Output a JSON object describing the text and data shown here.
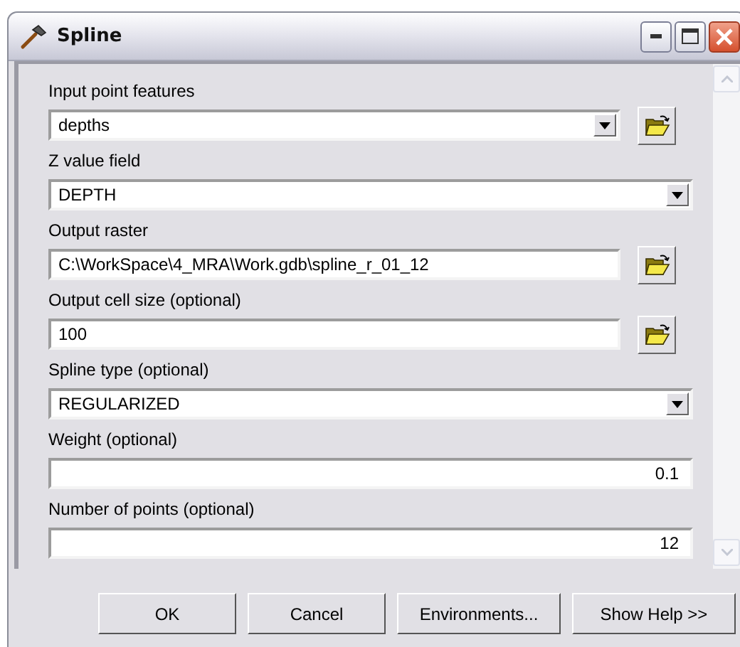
{
  "window": {
    "title": "Spline"
  },
  "fields": [
    {
      "label": "Input point features",
      "value": "depths",
      "kind": "combo",
      "browse": true
    },
    {
      "label": "Z value field",
      "value": "DEPTH",
      "kind": "combo",
      "browse": false
    },
    {
      "label": "Output raster",
      "value": "C:\\WorkSpace\\4_MRA\\Work.gdb\\spline_r_01_12",
      "kind": "text",
      "browse": true
    },
    {
      "label": "Output cell size (optional)",
      "value": "100",
      "kind": "text",
      "browse": true
    },
    {
      "label": "Spline type (optional)",
      "value": "REGULARIZED",
      "kind": "combo",
      "browse": false
    },
    {
      "label": "Weight (optional)",
      "value": "0.1",
      "kind": "number",
      "browse": false
    },
    {
      "label": "Number of points (optional)",
      "value": "12",
      "kind": "number",
      "browse": false
    }
  ],
  "buttons": [
    "OK",
    "Cancel",
    "Environments...",
    "Show Help >>"
  ]
}
